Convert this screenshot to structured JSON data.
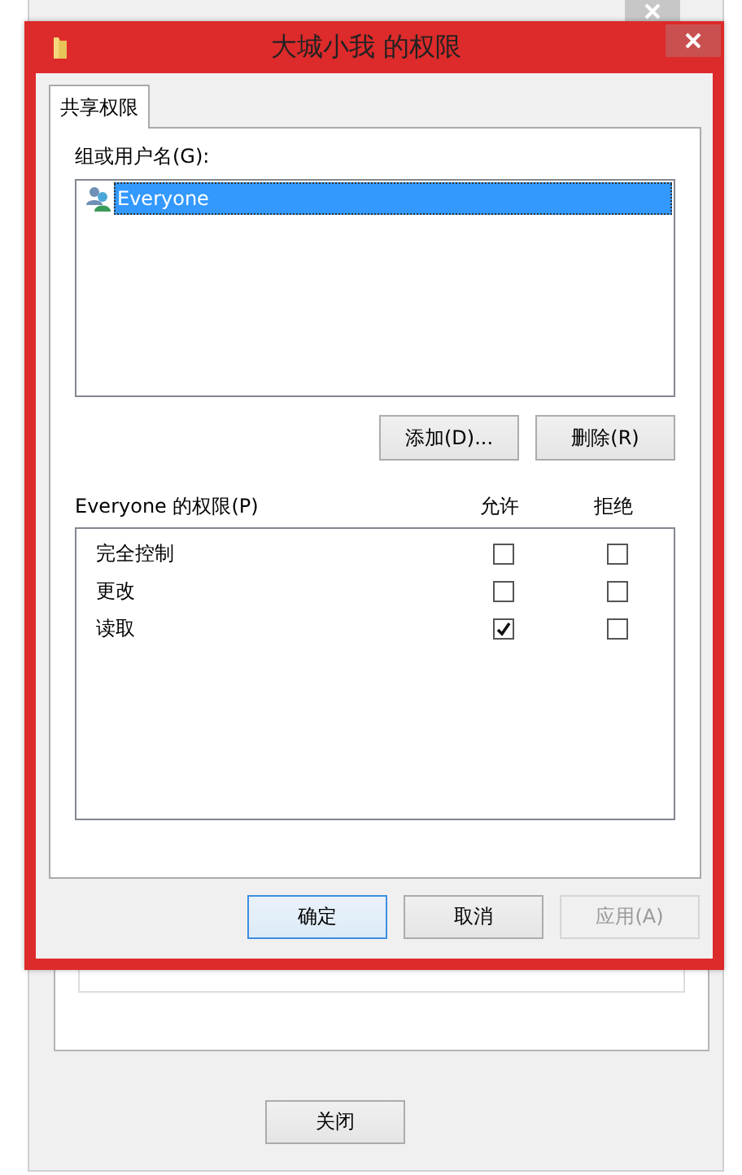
{
  "background_window": {
    "buttons": [
      "关闭"
    ]
  },
  "dialog": {
    "title": "大城小我 的权限",
    "tabs": [
      {
        "label": "共享权限",
        "selected": true
      }
    ],
    "groups_label": "组或用户名(G):",
    "users": [
      {
        "name": "Everyone",
        "selected": true
      }
    ],
    "user_buttons": [
      "添加(D)...",
      "删除(R)"
    ],
    "permissions_label": "Everyone 的权限(P)",
    "columns": [
      "允许",
      "拒绝"
    ],
    "permissions": [
      {
        "name": "完全控制",
        "allow": false,
        "deny": false
      },
      {
        "name": "更改",
        "allow": false,
        "deny": false
      },
      {
        "name": "读取",
        "allow": true,
        "deny": false
      }
    ],
    "buttons": [
      {
        "label": "确定",
        "default": true,
        "disabled": false
      },
      {
        "label": "取消",
        "default": false,
        "disabled": false
      },
      {
        "label": "应用(A)",
        "default": false,
        "disabled": true
      }
    ]
  }
}
